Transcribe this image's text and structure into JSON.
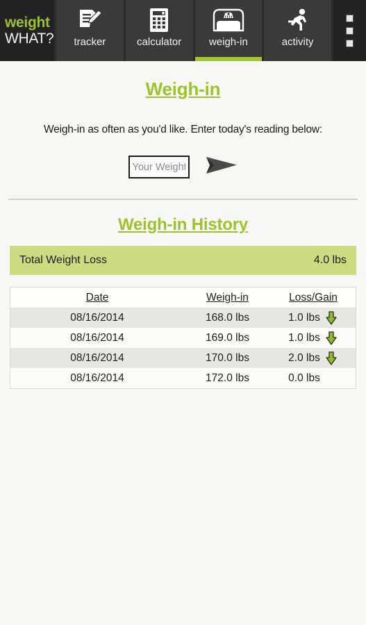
{
  "brand": {
    "line1": "weight",
    "line2": "WHAT?"
  },
  "tabs": [
    {
      "label": "tracker",
      "icon": "document-pencil-icon",
      "active": false
    },
    {
      "label": "calculator",
      "icon": "calculator-icon",
      "active": false
    },
    {
      "label": "weigh-in",
      "icon": "scale-icon",
      "active": true
    },
    {
      "label": "activity",
      "icon": "running-person-icon",
      "active": false
    }
  ],
  "overflow_menu": {
    "icon": "overflow-menu-icon"
  },
  "page": {
    "title": "Weigh-in",
    "subtitle": "Weigh-in as often as you'd like.  Enter today's reading below:"
  },
  "weigh_in_form": {
    "placeholder": "Your Weight",
    "value": "",
    "submit_icon": "send-arrow-icon"
  },
  "history": {
    "title": "Weigh-in History",
    "total_label": "Total Weight Loss",
    "total_value": "4.0 lbs",
    "columns": {
      "date": "Date",
      "weigh_in": "Weigh-in",
      "loss_gain": "Loss/Gain"
    },
    "rows": [
      {
        "date": "08/16/2014",
        "weigh_in": "168.0 lbs",
        "loss_gain": "1.0 lbs",
        "arrow": "down"
      },
      {
        "date": "08/16/2014",
        "weigh_in": "169.0 lbs",
        "loss_gain": "1.0 lbs",
        "arrow": "down"
      },
      {
        "date": "08/16/2014",
        "weigh_in": "170.0 lbs",
        "loss_gain": "2.0 lbs",
        "arrow": "down"
      },
      {
        "date": "08/16/2014",
        "weigh_in": "172.0 lbs",
        "loss_gain": "0.0 lbs",
        "arrow": "none"
      }
    ]
  },
  "colors": {
    "accent_green": "#9dc329",
    "tab_underline": "#a0c62a",
    "banner_green": "#ccdb80",
    "topbar_dark": "#3a3a3a",
    "brand_dark": "#232323",
    "page_background": "#f7f7f5",
    "arrow_green": "#8fbe1f"
  }
}
